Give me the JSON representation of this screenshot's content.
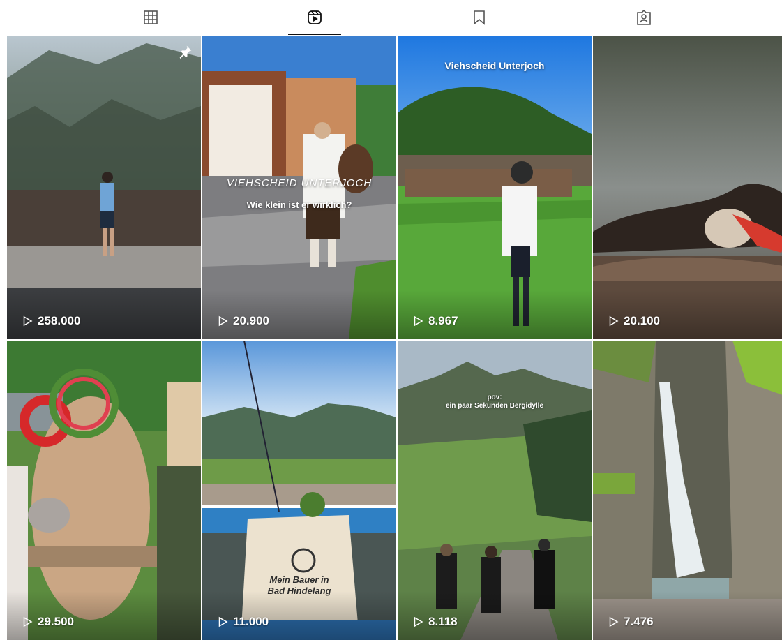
{
  "tabs": [
    {
      "icon": "grid-icon",
      "active": false
    },
    {
      "icon": "reels-icon",
      "active": true
    },
    {
      "icon": "bookmark-icon",
      "active": false
    },
    {
      "icon": "tagged-icon",
      "active": false
    }
  ],
  "reels": [
    {
      "views": "258.000",
      "pinned": true,
      "caption": ""
    },
    {
      "views": "20.900",
      "caption_top": "VIEHSCHEID UNTERJOCH",
      "caption_bottom": "Wie klein ist er wirklich?"
    },
    {
      "views": "8.967",
      "caption": "Viehscheid Unterjoch"
    },
    {
      "views": "20.100",
      "caption": ""
    },
    {
      "views": "29.500",
      "caption": ""
    },
    {
      "views": "11.000",
      "bag_text": "Mein Bauer in Bad Hindelang"
    },
    {
      "views": "8.118",
      "caption_line1": "pov:",
      "caption_line2": "ein paar Sekunden Bergidylle"
    },
    {
      "views": "7.476",
      "caption": ""
    }
  ]
}
